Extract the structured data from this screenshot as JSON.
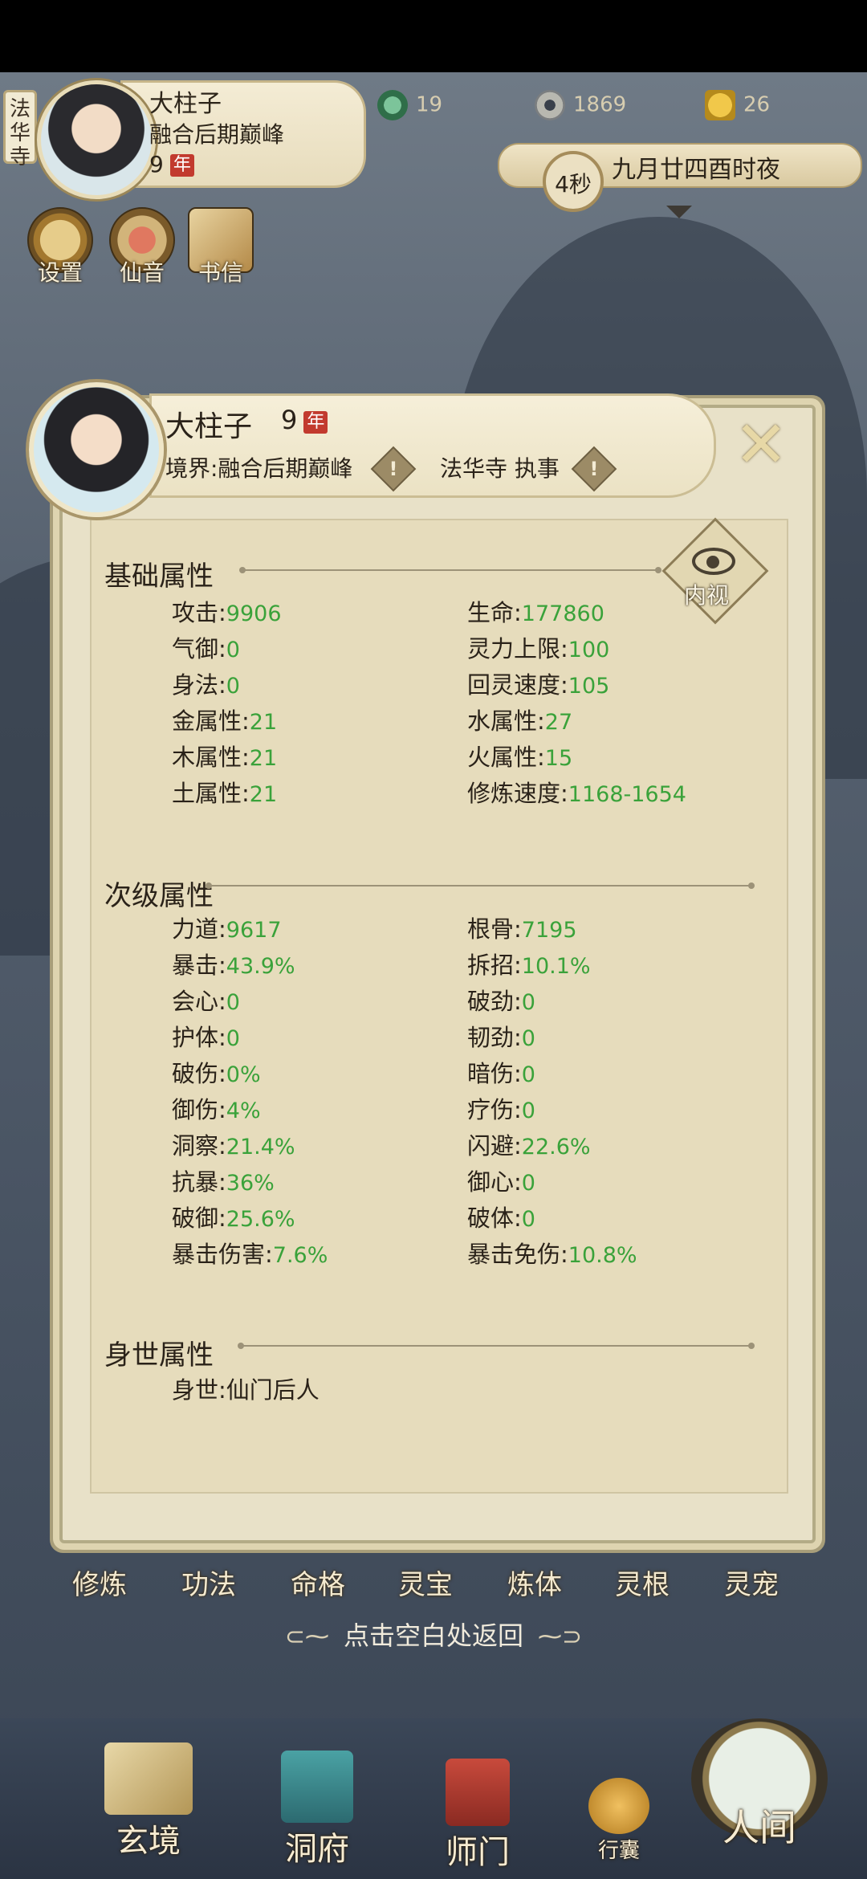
{
  "hud": {
    "sect_tag": "法华寺",
    "name": "大柱子",
    "realm": "融合后期巅峰",
    "age": "9",
    "age_unit": "年",
    "resources": [
      {
        "icon": "jade-dragon-icon",
        "value": "19"
      },
      {
        "icon": "coin-icon",
        "value": "1869"
      },
      {
        "icon": "strength-icon",
        "value": "26"
      }
    ],
    "timer": "4秒",
    "date_text": "九月廿四酉时夜",
    "quick_buttons": [
      "设置",
      "仙音",
      "书信"
    ]
  },
  "modal": {
    "name": "大柱子",
    "age": "9",
    "age_unit": "年",
    "realm": "境界:融合后期巅峰",
    "sect": "法华寺 执事",
    "inner_view": "内视",
    "basic": {
      "title": "基础属性",
      "left": [
        {
          "label": "攻击",
          "value": "9906"
        },
        {
          "label": "气御",
          "value": "0"
        },
        {
          "label": "身法",
          "value": "0"
        },
        {
          "label": "金属性",
          "value": "21"
        },
        {
          "label": "木属性",
          "value": "21"
        },
        {
          "label": "土属性",
          "value": "21"
        }
      ],
      "right": [
        {
          "label": "生命",
          "value": "177860"
        },
        {
          "label": "灵力上限",
          "value": "100"
        },
        {
          "label": "回灵速度",
          "value": "105"
        },
        {
          "label": "水属性",
          "value": "27"
        },
        {
          "label": "火属性",
          "value": "15"
        },
        {
          "label": "修炼速度",
          "value": "1168-1654"
        }
      ]
    },
    "secondary": {
      "title": "次级属性",
      "left": [
        {
          "label": "力道",
          "value": "9617"
        },
        {
          "label": "暴击",
          "value": "43.9%"
        },
        {
          "label": "会心",
          "value": "0"
        },
        {
          "label": "护体",
          "value": "0"
        },
        {
          "label": "破伤",
          "value": "0%"
        },
        {
          "label": "御伤",
          "value": "4%"
        },
        {
          "label": "洞察",
          "value": "21.4%"
        },
        {
          "label": "抗暴",
          "value": "36%"
        },
        {
          "label": "破御",
          "value": "25.6%"
        },
        {
          "label": "暴击伤害",
          "value": "7.6%"
        }
      ],
      "right": [
        {
          "label": "根骨",
          "value": "7195"
        },
        {
          "label": "拆招",
          "value": "10.1%"
        },
        {
          "label": "破劲",
          "value": "0"
        },
        {
          "label": "韧劲",
          "value": "0"
        },
        {
          "label": "暗伤",
          "value": "0"
        },
        {
          "label": "疗伤",
          "value": "0"
        },
        {
          "label": "闪避",
          "value": "22.6%"
        },
        {
          "label": "御心",
          "value": "0"
        },
        {
          "label": "破体",
          "value": "0"
        },
        {
          "label": "暴击免伤",
          "value": "10.8%"
        }
      ]
    },
    "background": {
      "title": "身世属性",
      "label": "身世",
      "value": "仙门后人"
    }
  },
  "tabs": [
    "修炼",
    "功法",
    "命格",
    "灵宝",
    "炼体",
    "灵根",
    "灵宠"
  ],
  "return_hint": "点击空白处返回",
  "bottom_nav": [
    "玄境",
    "洞府",
    "师门",
    "行囊",
    "人间"
  ],
  "colors": {
    "value_green": "#3aa23a",
    "badge_red": "#c23a2e",
    "panel": "#e8e1c8"
  }
}
